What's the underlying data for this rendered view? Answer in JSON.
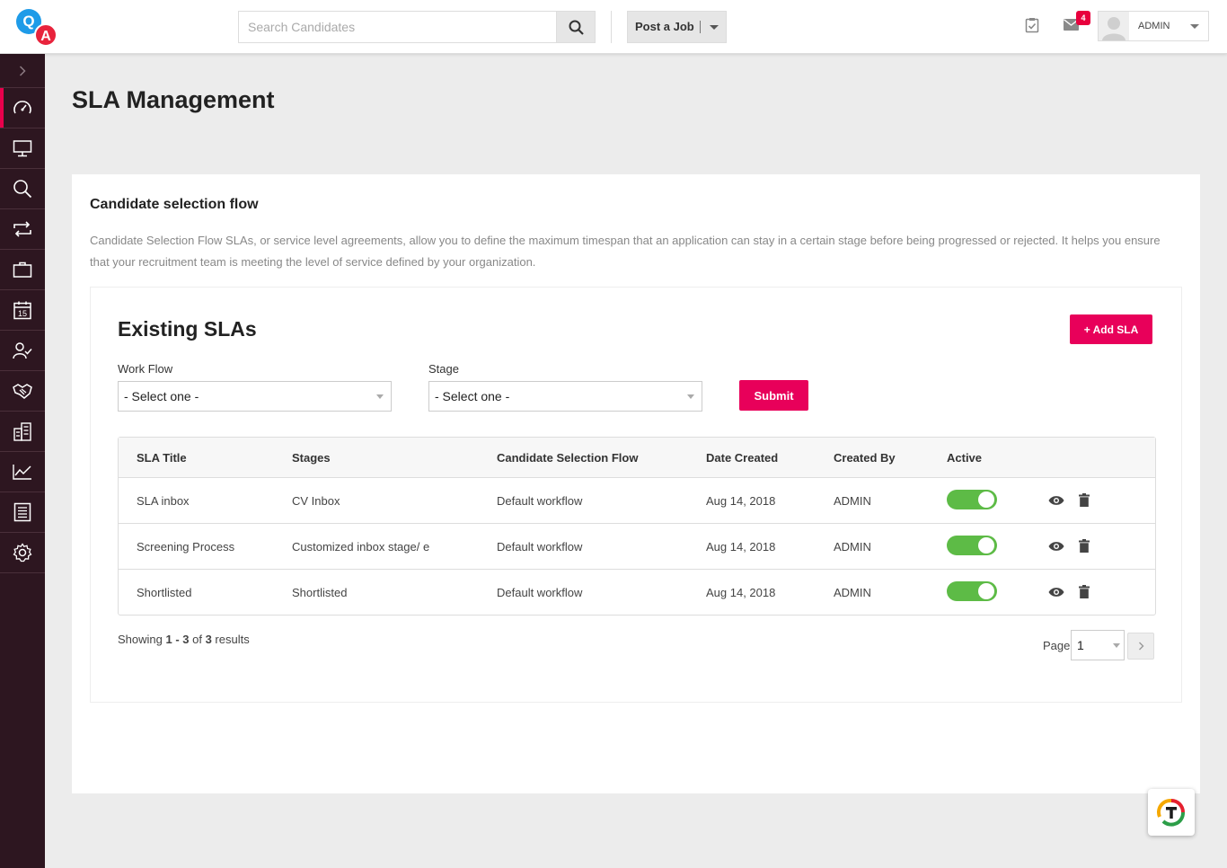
{
  "logo": {
    "q": "Q",
    "a": "A"
  },
  "header": {
    "search_placeholder": "Search Candidates",
    "post_job_label": "Post a Job",
    "mail_count": "4",
    "user_name": "ADMIN"
  },
  "sidebar": {
    "items": [
      "dashboard",
      "monitor",
      "search",
      "transfer",
      "jobs",
      "calendar",
      "candidates",
      "partners",
      "organization",
      "analytics",
      "reports",
      "settings"
    ],
    "active": "dashboard"
  },
  "page": {
    "title": "SLA Management"
  },
  "card": {
    "title": "Candidate selection flow",
    "description": "Candidate Selection Flow SLAs, or service level agreements, allow you to define the maximum timespan that an application can stay in a certain stage before being progressed or rejected. It helps you ensure that your recruitment team is meeting the level of service defined by your organization."
  },
  "existing": {
    "title": "Existing SLAs",
    "add_label": "+ Add SLA",
    "workflow_label": "Work Flow",
    "workflow_value": "- Select one -",
    "stage_label": "Stage",
    "stage_value": "- Select one -",
    "submit_label": "Submit"
  },
  "table": {
    "columns": [
      "SLA Title",
      "Stages",
      "Candidate Selection Flow",
      "Date Created",
      "Created By",
      "Active"
    ],
    "rows": [
      {
        "title": "SLA inbox",
        "stage": "CV Inbox",
        "flow": "Default workflow",
        "date": "Aug 14, 2018",
        "by": "ADMIN",
        "active": true
      },
      {
        "title": "Screening Process",
        "stage": "Customized inbox stage/ e",
        "flow": "Default workflow",
        "date": "Aug 14, 2018",
        "by": "ADMIN",
        "active": true
      },
      {
        "title": "Shortlisted",
        "stage": "Shortlisted",
        "flow": "Default workflow",
        "date": "Aug 14, 2018",
        "by": "ADMIN",
        "active": true
      }
    ]
  },
  "pagination": {
    "showing_prefix": "Showing ",
    "range": "1 - 3",
    "of": " of ",
    "total": "3",
    "suffix": " results",
    "page_label": "Page",
    "page_value": "1"
  },
  "colors": {
    "accent": "#e8005a",
    "sidebar_bg": "#2d1620",
    "toggle_on": "#5dbb46"
  }
}
